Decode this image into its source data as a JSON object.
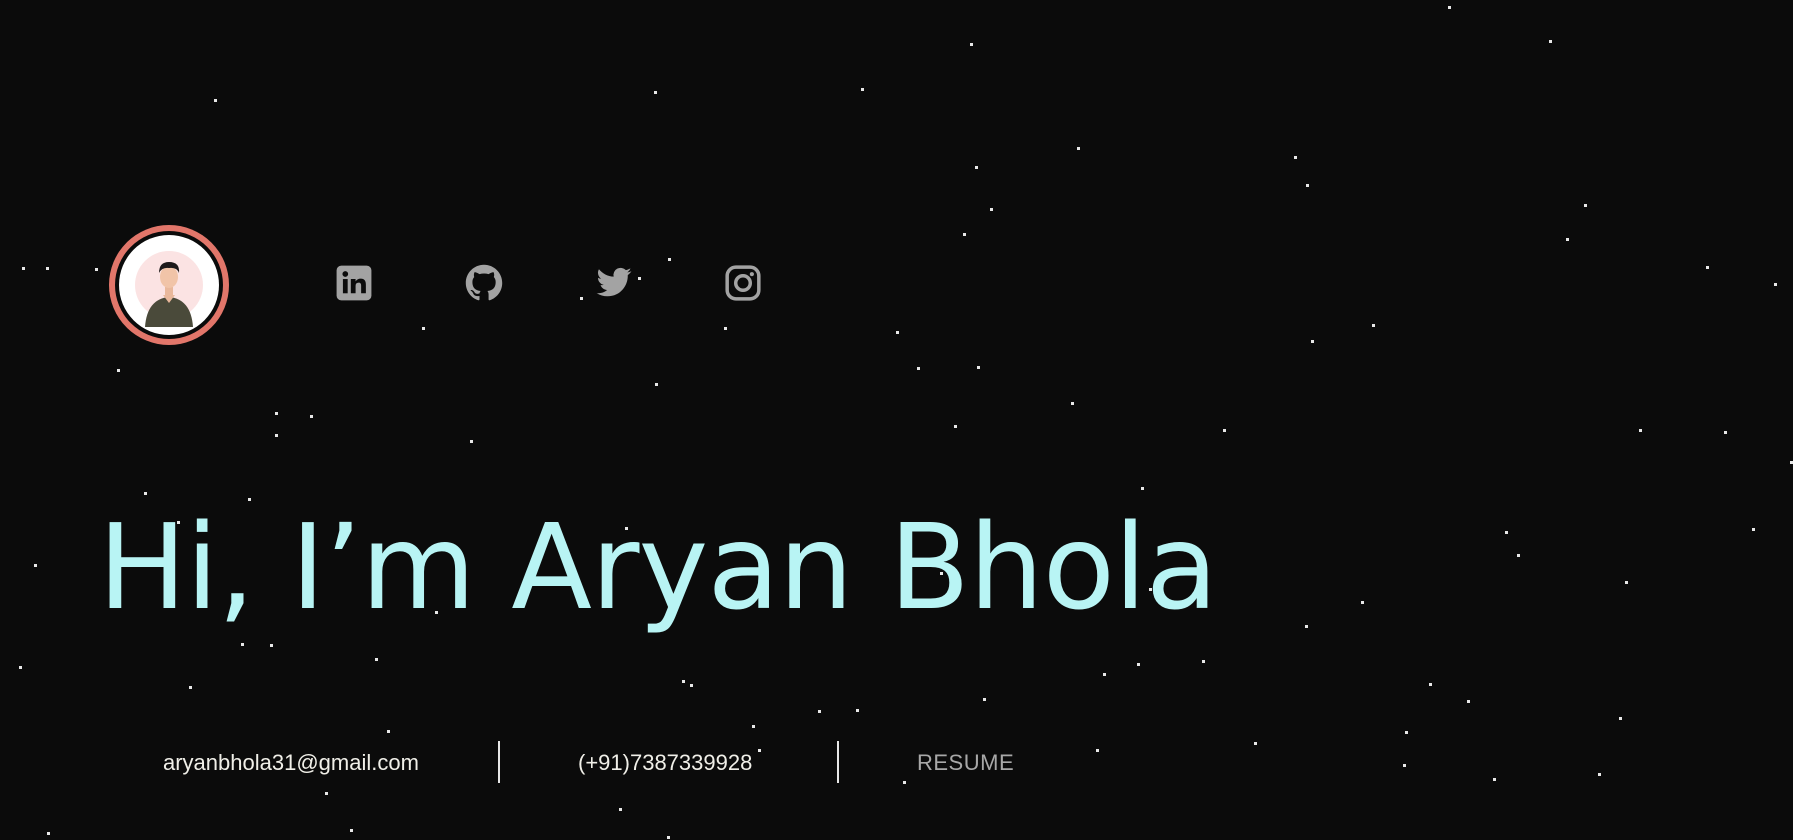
{
  "profile": {
    "avatar_ring_color": "#e2766a"
  },
  "social": [
    {
      "name": "LinkedIn",
      "icon": "linkedin-icon"
    },
    {
      "name": "GitHub",
      "icon": "github-icon"
    },
    {
      "name": "Twitter",
      "icon": "twitter-icon"
    },
    {
      "name": "Instagram",
      "icon": "instagram-icon"
    }
  ],
  "hero": {
    "title": "Hi, I’m Aryan Bhola",
    "title_color": "#b8f4f4"
  },
  "contact": {
    "email": "aryanbhola31@gmail.com",
    "phone": "(+91)7387339928",
    "resume_label": "RESUME"
  },
  "theme": {
    "background": "#0b0b0b",
    "icon_color": "#a3a3a3"
  }
}
